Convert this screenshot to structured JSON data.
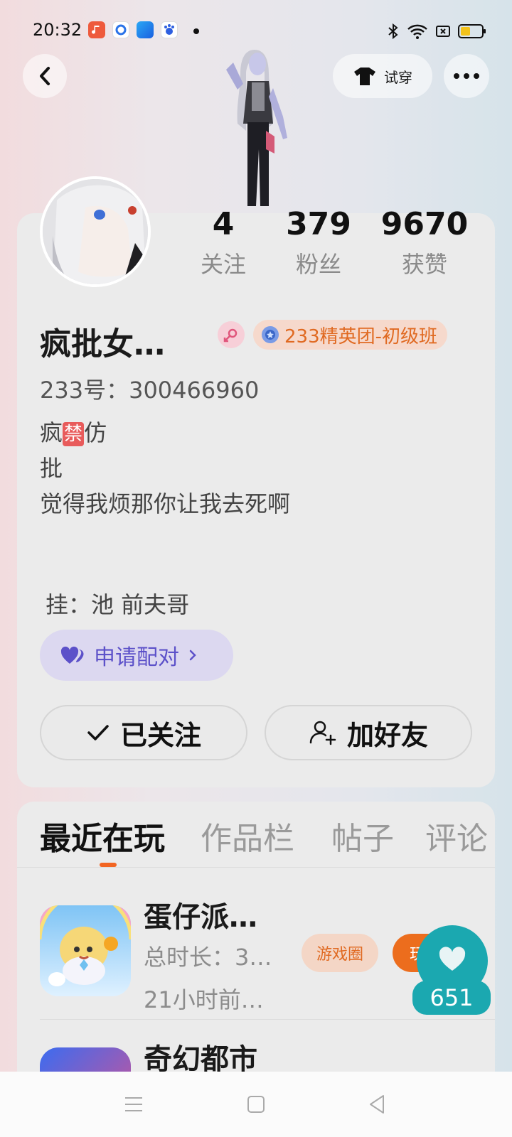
{
  "status_bar": {
    "time": "20:32",
    "app_icons": [
      "music-app-icon",
      "qq-browser-icon",
      "blue-app-icon",
      "baidu-icon"
    ],
    "battery_level": 0.45
  },
  "header": {
    "tryon_label": "试穿"
  },
  "profile": {
    "nickname": "疯批女…",
    "rank_badge": "233精英团-初级班",
    "user_id": "233号：300466960",
    "bio_line1_a": "疯",
    "bio_line1_ban": "禁",
    "bio_line1_b": "仿",
    "bio_line2": "批",
    "bio_line3": "觉得我烦那你让我去死啊",
    "extra": "挂：池  前夫哥",
    "pair_label": "申请配对",
    "stats": [
      {
        "value": "4",
        "label": "关注"
      },
      {
        "value": "379",
        "label": "粉丝"
      },
      {
        "value": "9670",
        "label": "获赞"
      }
    ],
    "follow_label": "已关注",
    "add_friend_label": "加好友"
  },
  "tabs": [
    {
      "label": "最近在玩",
      "active": true
    },
    {
      "label": "作品栏",
      "active": false
    },
    {
      "label": "帖子",
      "active": false
    },
    {
      "label": "评论",
      "active": false
    }
  ],
  "games": [
    {
      "name": "蛋仔派…",
      "duration": "总时长：3…",
      "last_played": "21小时前…",
      "circle_label": "游戏圈",
      "play_label": "玩"
    },
    {
      "name": "奇幻都市"
    }
  ],
  "like": {
    "count": "651"
  },
  "colors": {
    "accent_orange": "#ec6d1d",
    "like_teal": "#1ba8b0",
    "pair_purple": "#5c51c9"
  }
}
